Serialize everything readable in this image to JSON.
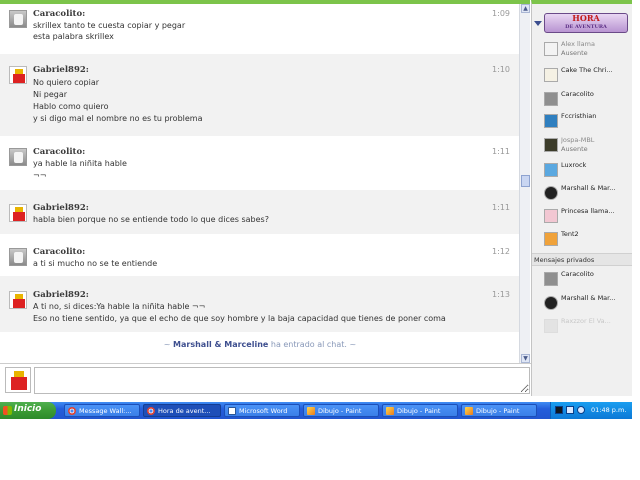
{
  "chat": {
    "messages": [
      {
        "user": "Caracolito:",
        "time": "1:09",
        "avatar": "caracolito-avatar",
        "lines": [
          "skrillex tanto te cuesta copiar y pegar",
          "esta palabra skrillex"
        ]
      },
      {
        "user": "Gabriel892:",
        "time": "1:10",
        "avatar": "gabriel-avatar",
        "lines": [
          "No quiero copiar",
          "Ni pegar",
          "Hablo como quiero",
          "y si digo mal el nombre no es tu problema"
        ]
      },
      {
        "user": "Caracolito:",
        "time": "1:11",
        "avatar": "caracolito-avatar",
        "lines": [
          "ya hable la niñita hable",
          "¬¬"
        ]
      },
      {
        "user": "Gabriel892:",
        "time": "1:11",
        "avatar": "gabriel-avatar",
        "lines": [
          "habla bien porque no se entiende todo lo que dices sabes?"
        ]
      },
      {
        "user": "Caracolito:",
        "time": "1:12",
        "avatar": "caracolito-avatar",
        "lines": [
          "a ti si mucho no se te entiende"
        ]
      },
      {
        "user": "Gabriel892:",
        "time": "1:13",
        "avatar": "gabriel-avatar",
        "lines": [
          "A ti no, si dices:Ya hable la niñita hable ¬¬",
          "Eso no tiene sentido, ya que el echo de que soy hombre y la baja capacidad que tienes de poner coma"
        ]
      }
    ],
    "join_notice": {
      "prefix": "~ ",
      "name": "Marshall & Marceline",
      "suffix": " ha entrado al chat. ~"
    },
    "input_value": ""
  },
  "sidebar": {
    "room_logo": {
      "title": "HORA",
      "subtitle": "DE AVENTURA"
    },
    "users": [
      {
        "name": "Alex llama",
        "status": "Ausente",
        "state": "away"
      },
      {
        "name": "Cake The Chri...",
        "status": "",
        "state": "online"
      },
      {
        "name": "Caracolito",
        "status": "",
        "state": "online"
      },
      {
        "name": "Fccristhian",
        "status": "",
        "state": "online"
      },
      {
        "name": "Jospa-MBL",
        "status": "Ausente",
        "state": "away"
      },
      {
        "name": "Luxrock",
        "status": "",
        "state": "online"
      },
      {
        "name": "Marshall & Mar...",
        "status": "",
        "state": "online"
      },
      {
        "name": "Princesa llama...",
        "status": "",
        "state": "online"
      },
      {
        "name": "Tent2",
        "status": "",
        "state": "online"
      }
    ],
    "private_header": "Mensajes privados",
    "private_users": [
      {
        "name": "Caracolito",
        "state": "online"
      },
      {
        "name": "Marshall & Mar...",
        "state": "online"
      },
      {
        "name": "Raxzzor El Va...",
        "state": "faded"
      }
    ]
  },
  "taskbar": {
    "start_label": "Inicio",
    "tasks": [
      {
        "label": "Message Wall:...",
        "icon": "chrome-icon",
        "active": false
      },
      {
        "label": "Hora de avent...",
        "icon": "chrome-icon",
        "active": true
      },
      {
        "label": "Microsoft Word",
        "icon": "word-icon",
        "active": false
      },
      {
        "label": "Dibujo - Paint",
        "icon": "paint-icon",
        "active": false
      },
      {
        "label": "Dibujo - Paint",
        "icon": "paint-icon",
        "active": false
      },
      {
        "label": "Dibujo - Paint",
        "icon": "paint-icon",
        "active": false
      }
    ],
    "clock": "01:48 p.m."
  },
  "colors": {
    "accent_green": "#7cc44a",
    "taskbar_blue": "#245edb",
    "start_green": "#3b9b34"
  }
}
